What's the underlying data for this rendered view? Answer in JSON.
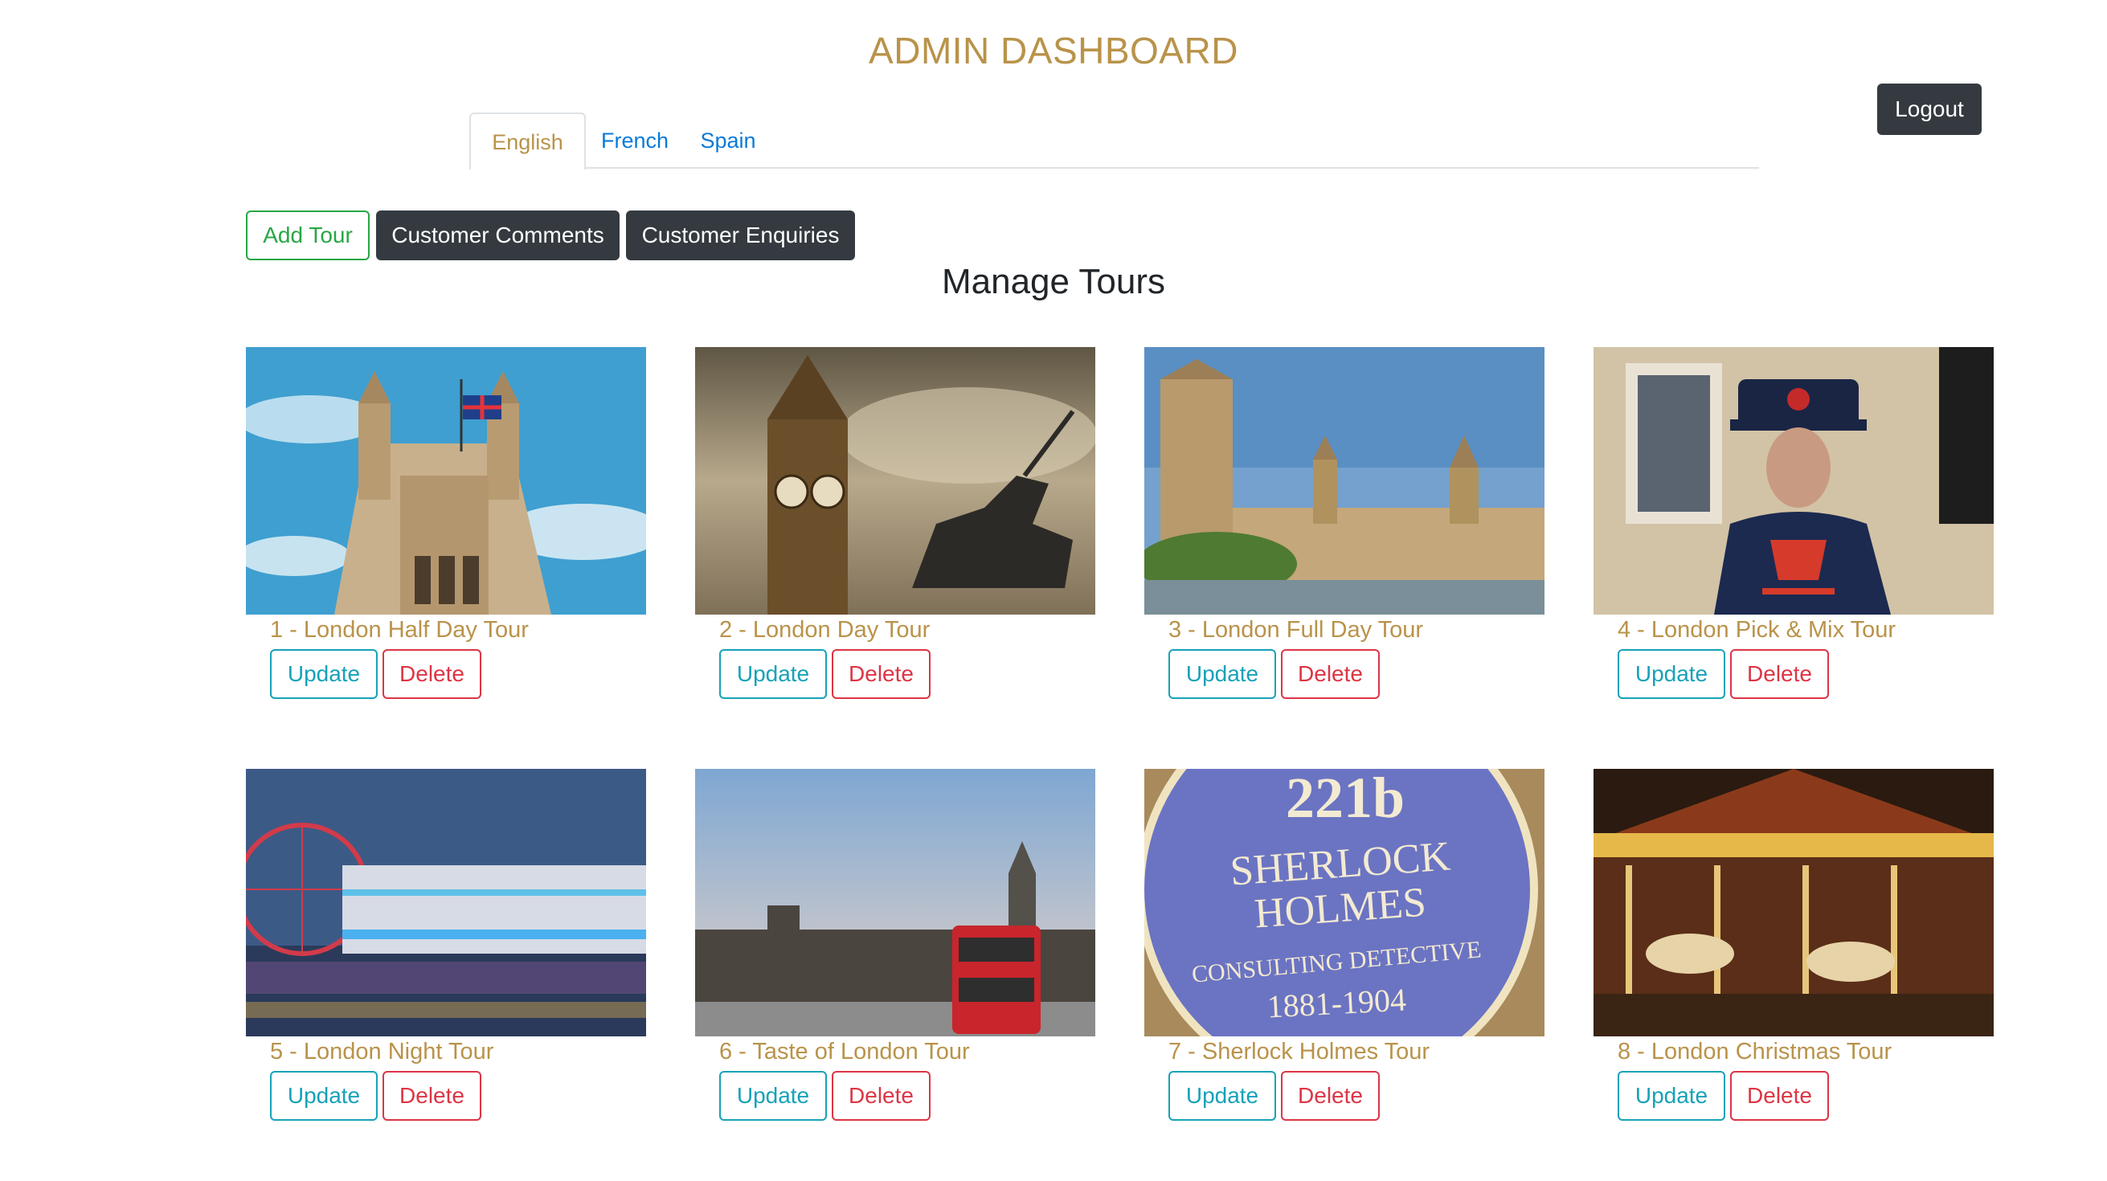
{
  "header": {
    "title": "ADMIN DASHBOARD",
    "logout_label": "Logout"
  },
  "tabs": [
    {
      "label": "English",
      "active": true
    },
    {
      "label": "French",
      "active": false
    },
    {
      "label": "Spain",
      "active": false
    }
  ],
  "toolbar": {
    "add_tour_label": "Add Tour",
    "comments_label": "Customer Comments",
    "enquiries_label": "Customer Enquiries"
  },
  "main": {
    "title": "Manage Tours",
    "update_label": "Update",
    "delete_label": "Delete",
    "tours": [
      {
        "title": "1 - London Half Day Tour",
        "image": "houses-of-parliament-tower-photo"
      },
      {
        "title": "2 - London Day Tour",
        "image": "big-ben-and-statue-photo"
      },
      {
        "title": "3 - London Full Day Tour",
        "image": "westminster-palace-photo"
      },
      {
        "title": "4 - London Pick & Mix Tour",
        "image": "beefeater-guard-photo"
      },
      {
        "title": "5 - London Night Tour",
        "image": "london-eye-night-photo"
      },
      {
        "title": "6 - Taste of London Tour",
        "image": "red-bus-westminster-photo"
      },
      {
        "title": "7 - Sherlock Holmes Tour",
        "image": "blue-plaque-221b-photo"
      },
      {
        "title": "8 - London Christmas Tour",
        "image": "christmas-carousel-photo"
      }
    ]
  },
  "plaque": {
    "line1": "221b",
    "line2": "SHERLOCK",
    "line3": "HOLMES",
    "line4": "CONSULTING DETECTIVE",
    "line5": "1881-1904"
  },
  "colors": {
    "accent_gold": "#b9934a",
    "dark_button": "#343a40",
    "tab_link": "#0a7ad8",
    "success": "#28a745",
    "info": "#17a2b8",
    "danger": "#dc3545"
  }
}
